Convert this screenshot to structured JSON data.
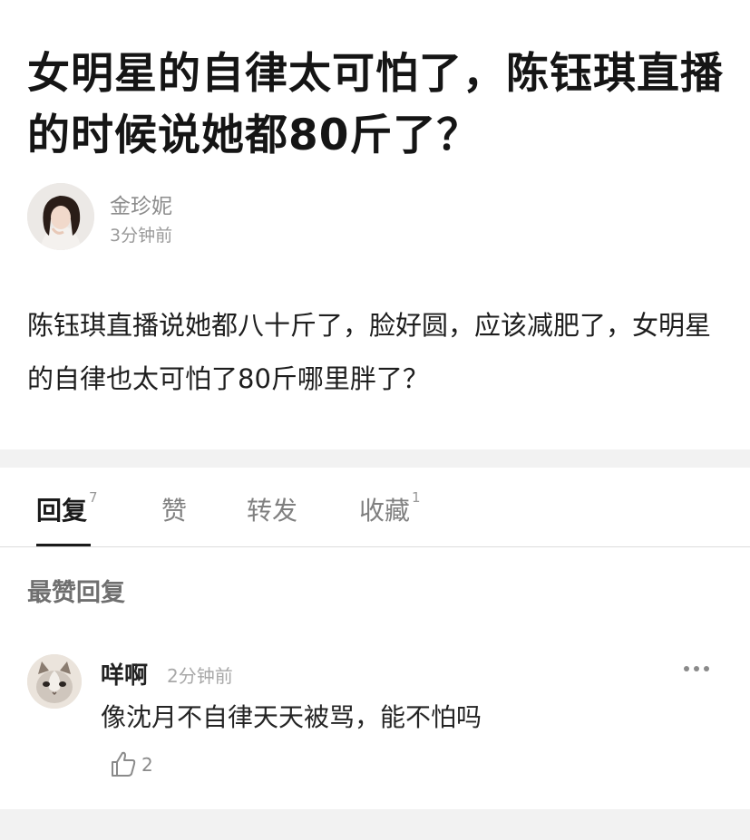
{
  "post": {
    "title": "女明星的自律太可怕了，陈钰琪直播的时候说她都80斤了？",
    "author": {
      "name": "金珍妮",
      "time": "3分钟前"
    },
    "body": "陈钰琪直播说她都八十斤了，脸好圆，应该减肥了，女明星的自律也太可怕了80斤哪里胖了？"
  },
  "tabs": [
    {
      "label": "回复",
      "count": "7",
      "active": true
    },
    {
      "label": "赞",
      "count": "",
      "active": false
    },
    {
      "label": "转发",
      "count": "",
      "active": false
    },
    {
      "label": "收藏",
      "count": "1",
      "active": false
    }
  ],
  "section_title": "最赞回复",
  "comment": {
    "user": "咩啊",
    "time": "2分钟前",
    "text": "像沈月不自律天天被骂，能不怕吗",
    "like_count": "2",
    "icons": {
      "more": "more-dots-icon",
      "like": "thumb-up-icon"
    }
  },
  "colors": {
    "active_tab": "#1a1a1a",
    "muted": "#808080",
    "band": "#f2f2f2"
  }
}
